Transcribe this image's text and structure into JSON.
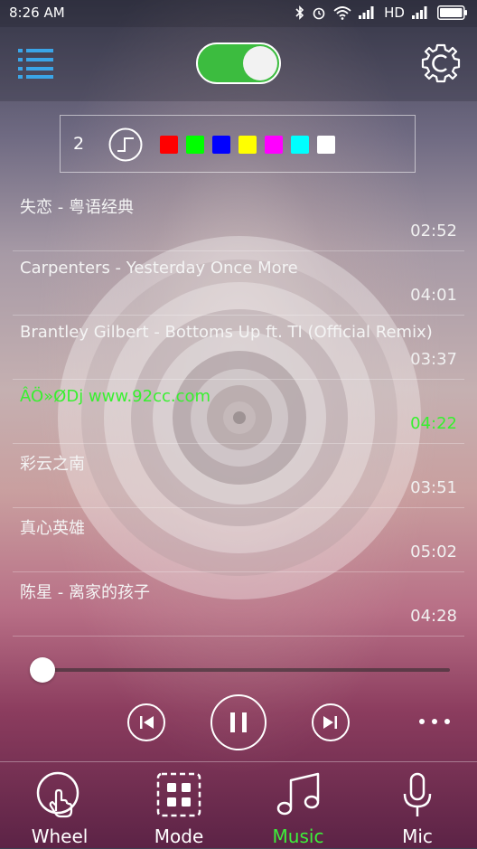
{
  "status_bar": {
    "time": "8:26 AM",
    "network": "HD"
  },
  "top_bar": {
    "toggle_on": true
  },
  "color_panel": {
    "number": "2",
    "colors": [
      "#ff0000",
      "#00ff00",
      "#0000ff",
      "#ffff00",
      "#ff00ff",
      "#00ffff",
      "#ffffff"
    ]
  },
  "songs": [
    {
      "title": "失恋 - 粤语经典",
      "duration": "02:52"
    },
    {
      "title": "Carpenters - Yesterday Once More",
      "duration": "04:01"
    },
    {
      "title": "Brantley Gilbert - Bottoms Up ft. TI (Official Remix)",
      "duration": "03:37"
    },
    {
      "title": "ÂÖ»ØDj www.92cc.com",
      "duration": "04:22"
    },
    {
      "title": "彩云之南",
      "duration": "03:51"
    },
    {
      "title": "真心英雄",
      "duration": "05:02"
    },
    {
      "title": "陈星 - 离家的孩子",
      "duration": "04:28"
    }
  ],
  "active_song_index": 3,
  "playback": {
    "progress": 0.02
  },
  "nav": {
    "wheel": "Wheel",
    "mode": "Mode",
    "music": "Music",
    "mic": "Mic"
  },
  "colors": {
    "accent_green": "#3cbc3f",
    "active_text": "#37f02f"
  }
}
